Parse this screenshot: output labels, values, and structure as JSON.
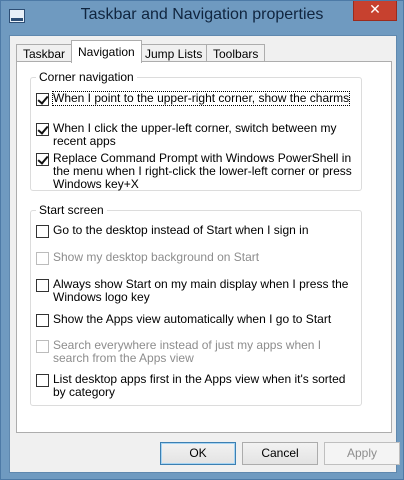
{
  "window": {
    "title": "Taskbar and Navigation properties",
    "close_label": "✕"
  },
  "tabs": [
    {
      "label": "Taskbar",
      "active": false
    },
    {
      "label": "Navigation",
      "active": true
    },
    {
      "label": "Jump Lists",
      "active": false
    },
    {
      "label": "Toolbars",
      "active": false
    }
  ],
  "corner_navigation": {
    "title": "Corner navigation",
    "options": [
      {
        "label": "When I point to the upper-right corner, show the charms",
        "checked": true,
        "enabled": true
      },
      {
        "label": "When I click the upper-left corner, switch between my recent apps",
        "checked": true,
        "enabled": true
      },
      {
        "label": "Replace Command Prompt with Windows PowerShell in the menu when I right-click the lower-left corner or press Windows key+X",
        "checked": true,
        "enabled": true
      }
    ]
  },
  "start_screen": {
    "title": "Start screen",
    "options": [
      {
        "label": "Go to the desktop instead of Start when I sign in",
        "checked": false,
        "enabled": true
      },
      {
        "label": "Show my desktop background on Start",
        "checked": false,
        "enabled": false
      },
      {
        "label": "Always show Start on my main display when I press the Windows logo key",
        "checked": false,
        "enabled": true
      },
      {
        "label": "Show the Apps view automatically when I go to Start",
        "checked": false,
        "enabled": true
      },
      {
        "label": "Search everywhere instead of just my apps when I search from the Apps view",
        "checked": false,
        "enabled": false
      },
      {
        "label": "List desktop apps first in the Apps view when it's sorted by category",
        "checked": false,
        "enabled": true
      }
    ]
  },
  "buttons": {
    "ok": "OK",
    "cancel": "Cancel",
    "apply": "Apply"
  }
}
